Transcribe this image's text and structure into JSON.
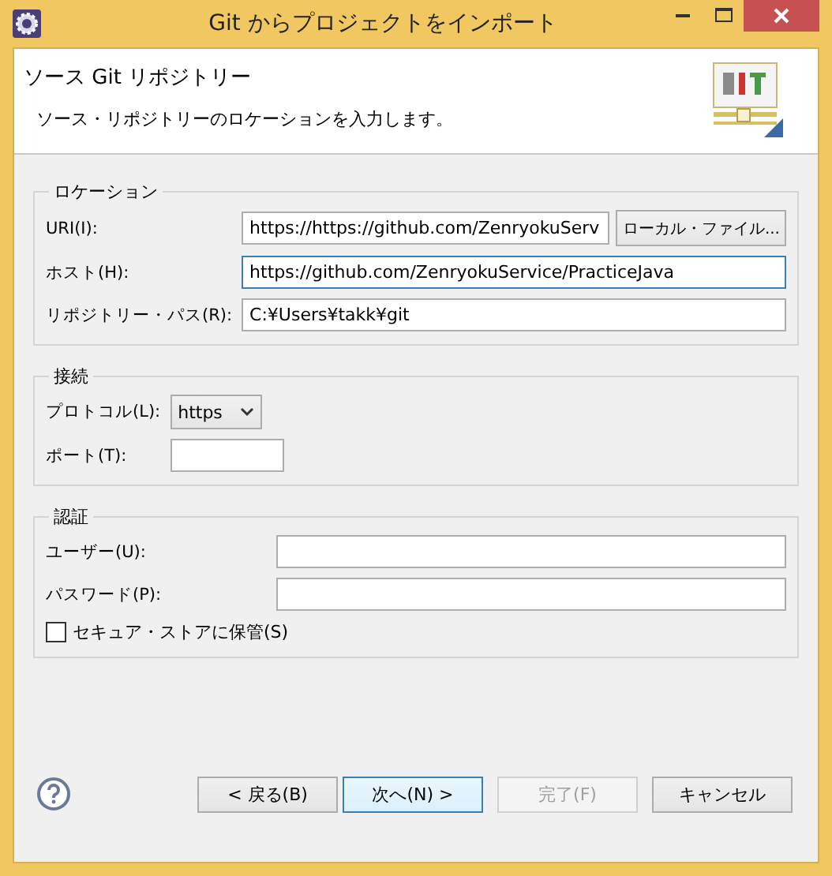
{
  "window": {
    "title": "Git からプロジェクトをインポート"
  },
  "header": {
    "title": "ソース Git リポジトリー",
    "description": "ソース・リポジトリーのロケーションを入力します。"
  },
  "groups": [
    {
      "legend": "ロケーション",
      "fields": [
        {
          "kind": "text-button",
          "label": "URI(I):",
          "value": "https://https://github.com/ZenryokuServ",
          "focused": false,
          "button": "ローカル・ファイル..."
        },
        {
          "kind": "text",
          "label": "ホスト(H):",
          "value": "https://github.com/ZenryokuService/PracticeJava",
          "focused": true
        },
        {
          "kind": "text",
          "label": "リポジトリー・パス(R):",
          "value": "C:¥Users¥takk¥git",
          "focused": false
        }
      ]
    },
    {
      "legend": "接続",
      "fields": [
        {
          "kind": "select",
          "label": "プロトコル(L):",
          "value": "https"
        },
        {
          "kind": "short-text",
          "label": "ポート(T):",
          "focused": false
        }
      ]
    },
    {
      "legend": "認証",
      "fields": [
        {
          "kind": "text",
          "label": "ユーザー(U):",
          "focused": false
        },
        {
          "kind": "text",
          "label": "パスワード(P):",
          "focused": false
        },
        {
          "kind": "checkbox",
          "label": "セキュア・ストアに保管(S)",
          "checked": false
        }
      ]
    }
  ],
  "buttons": [
    {
      "label": "< 戻る(B)",
      "disabled": false,
      "default": false
    },
    {
      "label": "次へ(N) >",
      "disabled": false,
      "default": true
    },
    {
      "label": "完了(F)",
      "disabled": true,
      "default": false
    },
    {
      "label": "キャンセル",
      "disabled": false,
      "default": false
    }
  ]
}
